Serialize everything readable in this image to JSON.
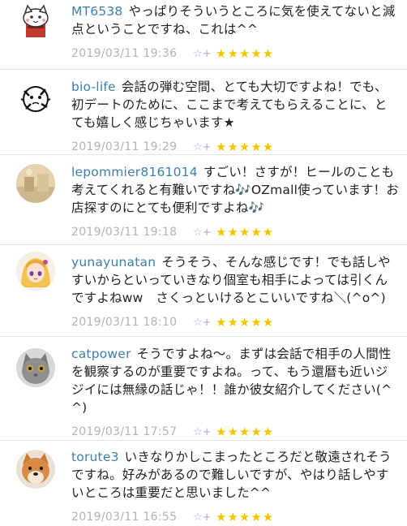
{
  "comments": [
    {
      "user": "MT6538",
      "text": "やっぱりそういうところに気を使えてないと減点ということですね、これは^^",
      "date": "2019/03/11 19:36",
      "fav_icon": "☆+",
      "stars": "★★★★★",
      "avatar": "cat-icon"
    },
    {
      "user": "bio-life",
      "text": "会話の弾む空間、とても大切ですよね！でも、初デートのために、ここまで考えてもらえることに、とても嬉しく感じちゃいます★",
      "date": "2019/03/11 19:29",
      "fav_icon": "☆+",
      "stars": "★★★★★",
      "avatar": "sketch-icon"
    },
    {
      "user": "lepommier8161014",
      "text": "すごい！さすが！ヒールのことも考えてくれると有難いですね🎶OZmall使っています！お店探すのにとても便利ですよね🎶",
      "date": "2019/03/11 19:18",
      "fav_icon": "☆+",
      "stars": "★★★★★",
      "avatar": "photo-icon"
    },
    {
      "user": "yunayunatan",
      "text": "そうそう、そんな感じです！でも話しやすいからといっていきなり個室も相手によっては引くんですよねww　さくっといけるとこいいですね＼(^o^)",
      "date": "2019/03/11 18:10",
      "fav_icon": "☆+",
      "stars": "★★★★★",
      "avatar": "anime-girl-icon"
    },
    {
      "user": "catpower",
      "text": "そうですよね〜。まずは会話で相手の人間性を観察するのが重要ですよね。って、もう還暦も近いジジイには無縁の話じゃ！！誰か彼女紹介してください(^^)",
      "date": "2019/03/11 17:57",
      "fav_icon": "☆+",
      "stars": "★★★★★",
      "avatar": "grey-cat-icon"
    },
    {
      "user": "torute3",
      "text": "いきなりかしこまったところだと敬遠されそうですね。好みがあるので難しいですが、やはり話しやすいところは重要だと思いました^^",
      "date": "2019/03/11 16:55",
      "fav_icon": "☆+",
      "stars": "★★★★★",
      "avatar": "shiba-dog-icon"
    }
  ]
}
